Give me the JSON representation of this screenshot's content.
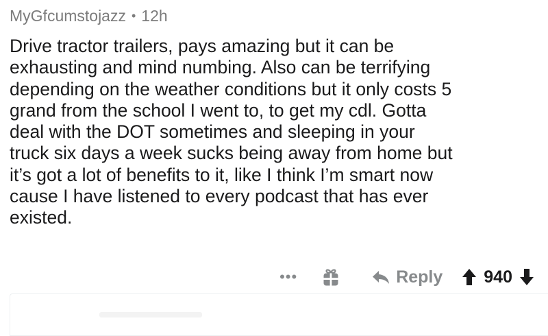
{
  "comment": {
    "author": "MyGfcumstojazz",
    "separator": "•",
    "time": "12h",
    "body_lines": [
      "Drive tractor trailers, pays amazing but it can be",
      "exhausting and mind numbing. Also can be terrifying",
      "depending on the weather conditions but it only costs 5",
      "grand from the school I went to, to get my cdl. Gotta",
      "deal with the DOT sometimes and sleeping in your",
      "truck six days a week sucks being away from home but",
      "it’s got a lot of benefits to it, like I think I’m smart now",
      "cause I have listened to every podcast that has ever",
      "existed."
    ]
  },
  "actions": {
    "more_label": "•••",
    "reply_label": "Reply",
    "score": "940"
  },
  "icons": {
    "more": "more-options-icon",
    "award": "gift-award-icon",
    "reply": "reply-arrow-icon",
    "upvote": "upvote-arrow-icon",
    "downvote": "downvote-arrow-icon"
  },
  "colors": {
    "meta_text": "#7c7c7c",
    "body_text": "#1a1a1b",
    "action_gray": "#878a8c",
    "score_text": "#1a1a1b"
  }
}
